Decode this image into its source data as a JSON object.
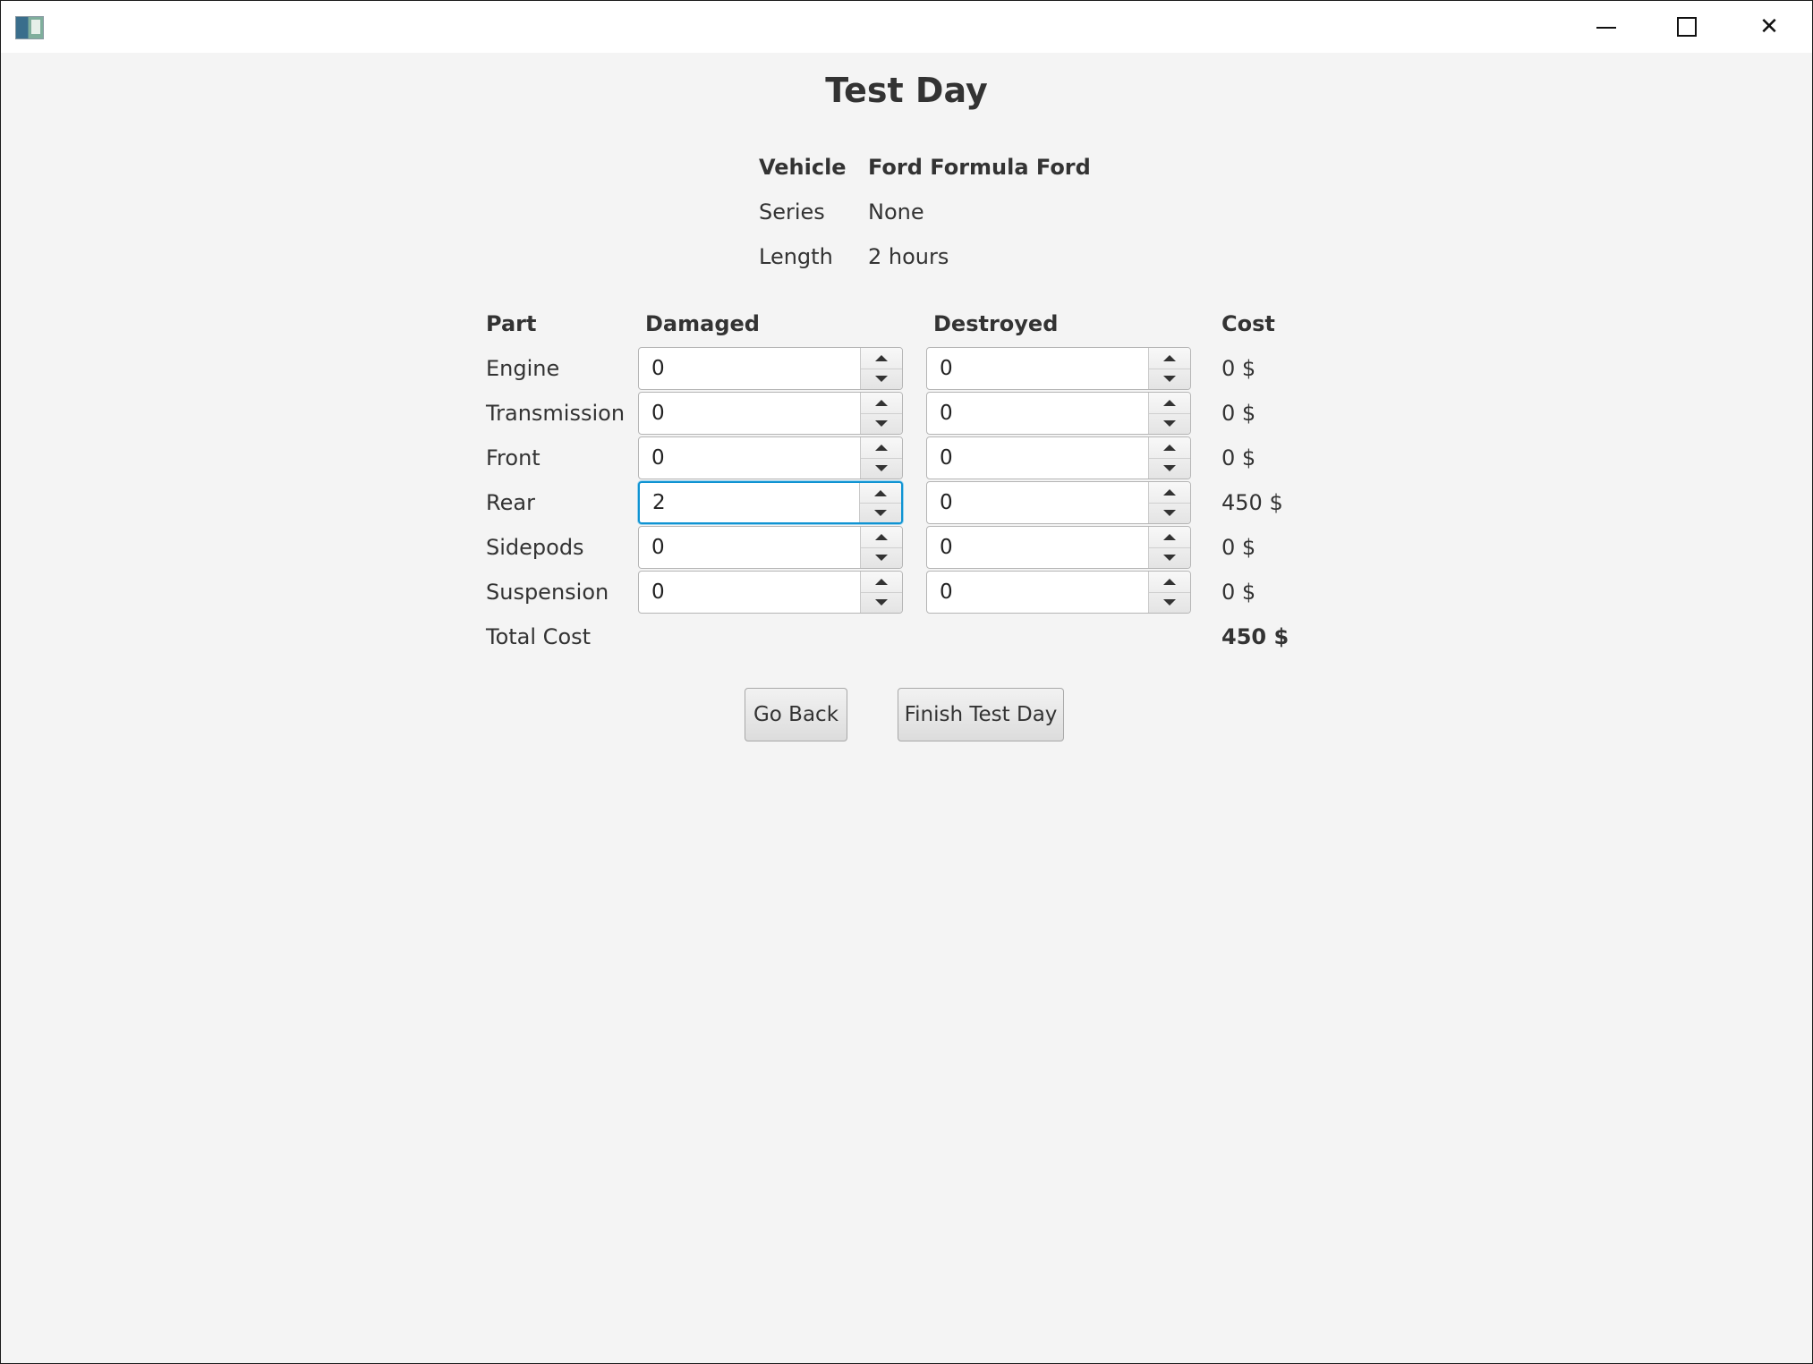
{
  "window": {
    "icons": {
      "app": "app-icon",
      "minimize": "minimize-icon",
      "maximize": "maximize-icon",
      "close": "close-icon"
    }
  },
  "title": "Test Day",
  "info": {
    "vehicle_label": "Vehicle",
    "vehicle_value": "Ford Formula Ford",
    "series_label": "Series",
    "series_value": "None",
    "length_label": "Length",
    "length_value": "2 hours"
  },
  "table": {
    "headers": {
      "part": "Part",
      "damaged": "Damaged",
      "destroyed": "Destroyed",
      "cost": "Cost"
    },
    "rows": [
      {
        "part": "Engine",
        "damaged": "0",
        "destroyed": "0",
        "cost": "0 $"
      },
      {
        "part": "Transmission",
        "damaged": "0",
        "destroyed": "0",
        "cost": "0 $"
      },
      {
        "part": "Front",
        "damaged": "0",
        "destroyed": "0",
        "cost": "0 $"
      },
      {
        "part": "Rear",
        "damaged": "2",
        "destroyed": "0",
        "cost": "450 $"
      },
      {
        "part": "Sidepods",
        "damaged": "0",
        "destroyed": "0",
        "cost": "0 $"
      },
      {
        "part": "Suspension",
        "damaged": "0",
        "destroyed": "0",
        "cost": "0 $"
      }
    ],
    "total_label": "Total Cost",
    "total_value": "450 $"
  },
  "buttons": {
    "go_back": "Go Back",
    "finish": "Finish Test Day"
  },
  "colors": {
    "focus": "#0f93d2",
    "background": "#f4f4f4"
  }
}
